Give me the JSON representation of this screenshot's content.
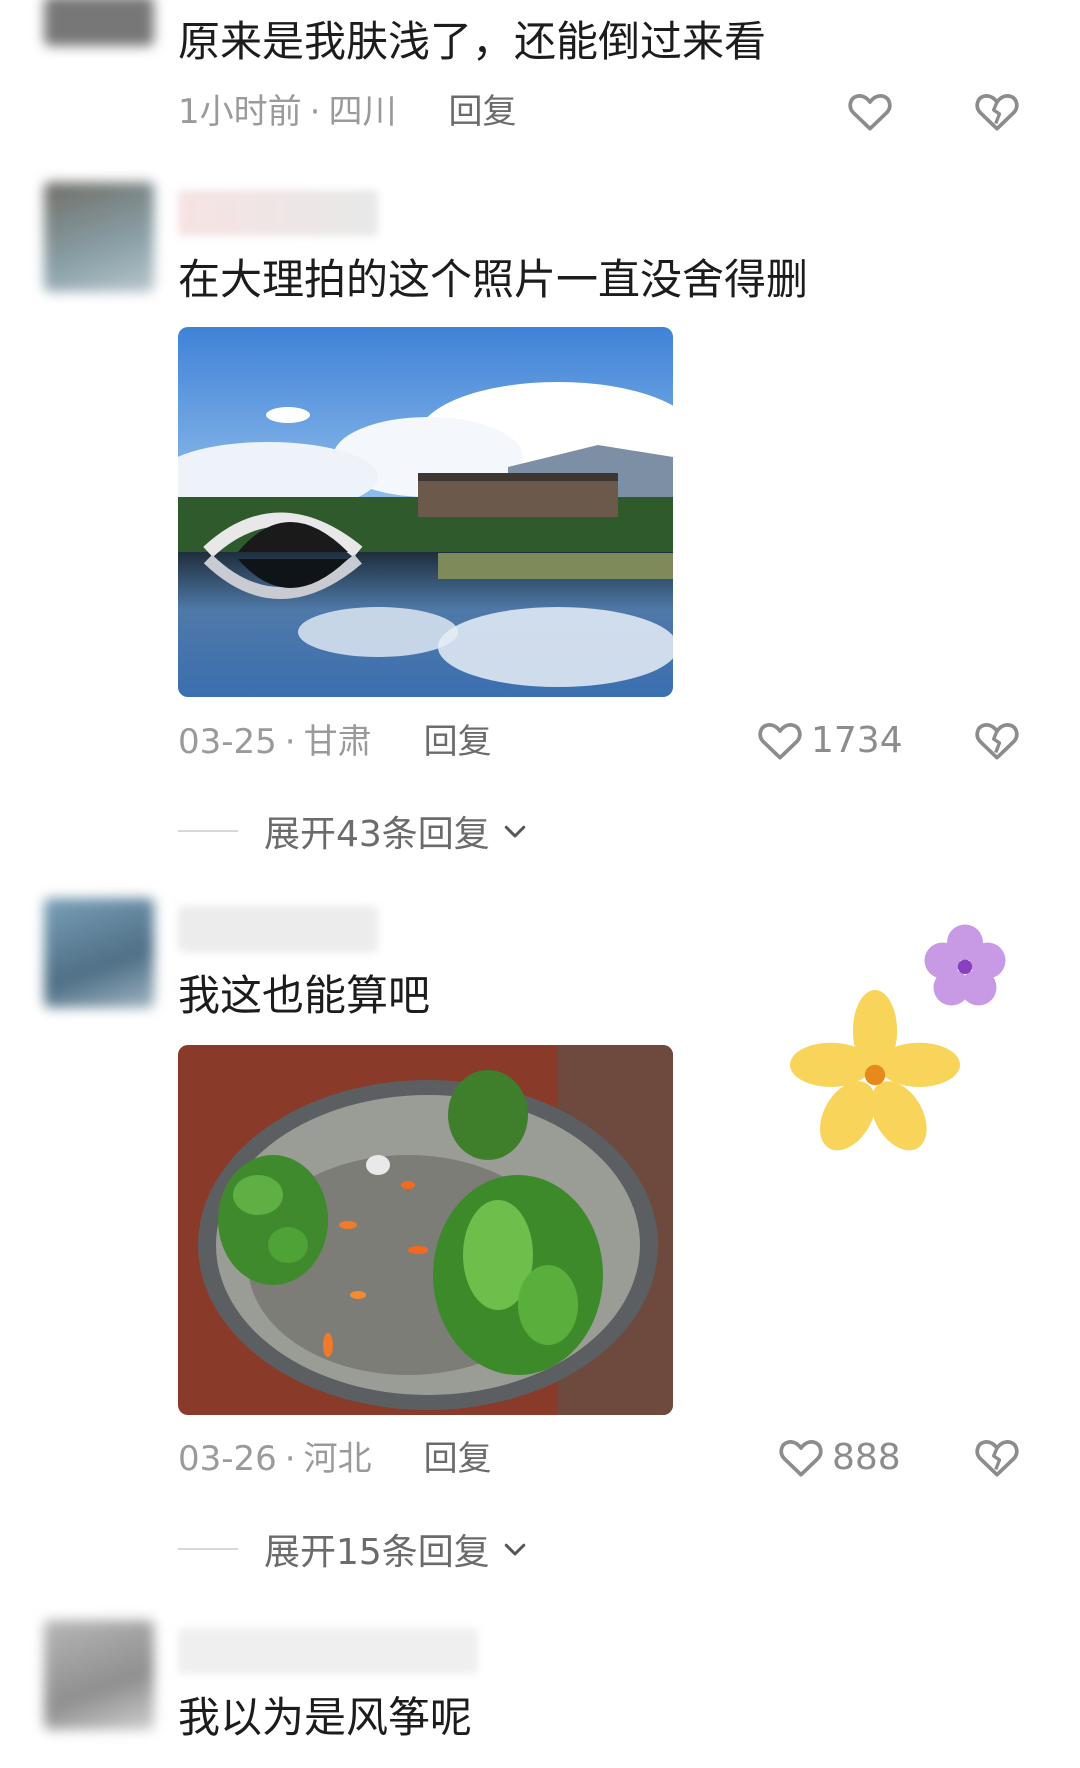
{
  "comments": [
    {
      "text": "原来是我肤浅了，还能倒过来看",
      "time": "1小时前",
      "location": "四川",
      "reply_label": "回复",
      "like_count": ""
    },
    {
      "text": "在大理拍的这个照片一直没舍得删",
      "photo": "lake-arch-bridge-reflection",
      "time": "03-25",
      "location": "甘肃",
      "reply_label": "回复",
      "like_count": "1734",
      "expand_label": "展开43条回复"
    },
    {
      "text": "我这也能算吧",
      "photo": "fish-bowl-aquascape",
      "time": "03-26",
      "location": "河北",
      "reply_label": "回复",
      "like_count": "888",
      "expand_label": "展开15条回复"
    },
    {
      "text": "我以为是风筝呢"
    }
  ],
  "meta_separator": "·",
  "icons": {
    "like": "heart-outline-icon",
    "dislike": "broken-heart-icon",
    "expand": "chevron-down-icon"
  },
  "colors": {
    "text": "#1c1c1c",
    "meta": "#9a9a9a",
    "reply": "#6b6b6b"
  }
}
